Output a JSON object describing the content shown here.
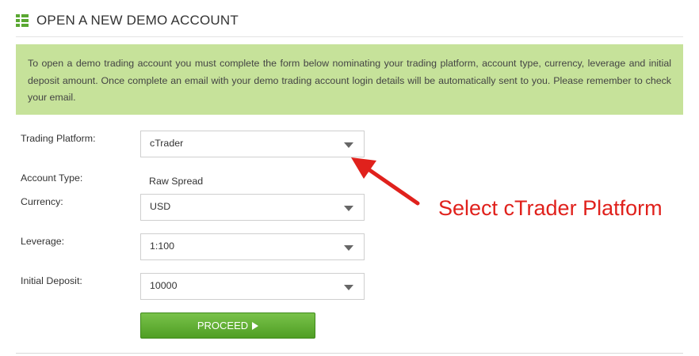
{
  "header": {
    "title": "OPEN A NEW DEMO ACCOUNT",
    "icon": "list-icon",
    "accent_color": "#5aa832"
  },
  "info": {
    "text": "To open a demo trading account you must complete the form below nominating your trading platform, account type, currency, leverage and initial deposit amount. Once complete an email with your demo trading account login details will be automatically sent to you. Please remember to check your email.",
    "background_color": "#c6e29a"
  },
  "form": {
    "platform": {
      "label": "Trading Platform:",
      "value": "cTrader"
    },
    "account_type": {
      "label": "Account Type:",
      "value": "Raw Spread"
    },
    "currency": {
      "label": "Currency:",
      "value": "USD"
    },
    "leverage": {
      "label": "Leverage:",
      "value": "1:100"
    },
    "deposit": {
      "label": "Initial Deposit:",
      "value": "10000"
    },
    "proceed_label": "PROCEED"
  },
  "annotation": {
    "text": "Select cTrader Platform",
    "color": "#e0211c"
  }
}
